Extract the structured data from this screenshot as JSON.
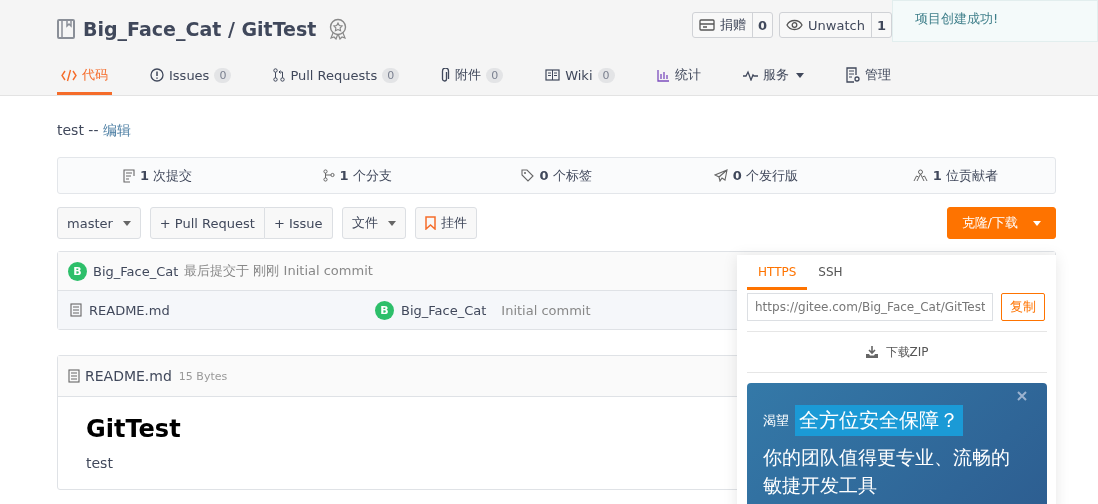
{
  "title": "Big_Face_Cat / GitTest",
  "actions": [
    {
      "kind": "donate",
      "label": "捐赠",
      "count": "0"
    },
    {
      "kind": "watch",
      "label": "Unwatch",
      "count": "1"
    }
  ],
  "toast": "项目创建成功!",
  "tabs": [
    {
      "kind": "code",
      "label": "代码",
      "selected": true
    },
    {
      "kind": "issues",
      "label": "Issues",
      "count": "0",
      "selected": false
    },
    {
      "kind": "pulls",
      "label": "Pull Requests",
      "count": "0",
      "selected": false
    },
    {
      "kind": "attach",
      "label": "附件",
      "count": "0",
      "selected": false
    },
    {
      "kind": "wiki",
      "label": "Wiki",
      "count": "0",
      "selected": false
    },
    {
      "kind": "stats",
      "label": "统计",
      "selected": false
    },
    {
      "kind": "services",
      "label": "服务",
      "selected": false
    },
    {
      "kind": "manage",
      "label": "管理",
      "selected": false
    }
  ],
  "description": {
    "text": "test --",
    "link": "编辑"
  },
  "stats": [
    {
      "kind": "commits",
      "count": "1",
      "label": "次提交"
    },
    {
      "kind": "branches",
      "count": "1",
      "label": "个分支"
    },
    {
      "kind": "tags",
      "count": "0",
      "label": "个标签"
    },
    {
      "kind": "releases",
      "count": "0",
      "label": "个发行版"
    },
    {
      "kind": "contributors",
      "count": "1",
      "label": "位贡献者"
    }
  ],
  "toolbar": {
    "branch": "master",
    "pull_request": "+ Pull Request",
    "issue": "+ Issue",
    "files": "文件",
    "widget": "挂件",
    "clone": "克隆/下载"
  },
  "commit": {
    "avatar": "B",
    "author": "Big_Face_Cat",
    "text": "最后提交于 刚刚 Initial commit"
  },
  "files": [
    {
      "name": "README.md",
      "avatar": "B",
      "author": "Big_Face_Cat",
      "message": "Initial commit"
    }
  ],
  "readme": {
    "filename": "README.md",
    "size": "15 Bytes",
    "heading": "GitTest",
    "body": "test"
  },
  "clone": {
    "tabs": [
      {
        "label": "HTTPS",
        "selected": true
      },
      {
        "label": "SSH",
        "selected": false
      }
    ],
    "url": "https://gitee.com/Big_Face_Cat/GitTest",
    "copy": "复制",
    "download": "下载ZIP"
  },
  "ad": {
    "prefix": "渴望",
    "headline": "全方位安全保障？",
    "body": "你的团队值得更专业、流畅的敏捷开发工具"
  }
}
